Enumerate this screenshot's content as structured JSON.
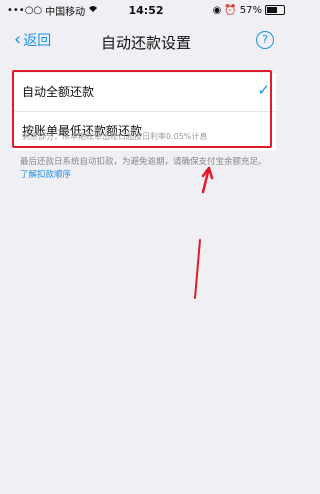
{
  "status_bar": {
    "signal": "•••○○",
    "carrier": "中国移动",
    "time": "14:52",
    "battery": "57%",
    "battery_level": 0.57
  },
  "nav": {
    "back_label": "返回",
    "title": "自动还款设置",
    "help_symbol": "?"
  },
  "options": [
    {
      "label": "自动全额还款",
      "selected": true
    },
    {
      "label": "按账单最低还款额还款",
      "selected": false
    }
  ],
  "option_note": "剩余部分，从本期账单出账日起按日利率0.05%计息",
  "note": {
    "text": "最后还款日系统自动扣款，为避免逾期，请确保支付宝余额充足。",
    "link": "了解扣款顺序"
  },
  "colors": {
    "accent": "#1a90e6",
    "highlight": "#e01b2c",
    "background": "#f0f0f4"
  }
}
